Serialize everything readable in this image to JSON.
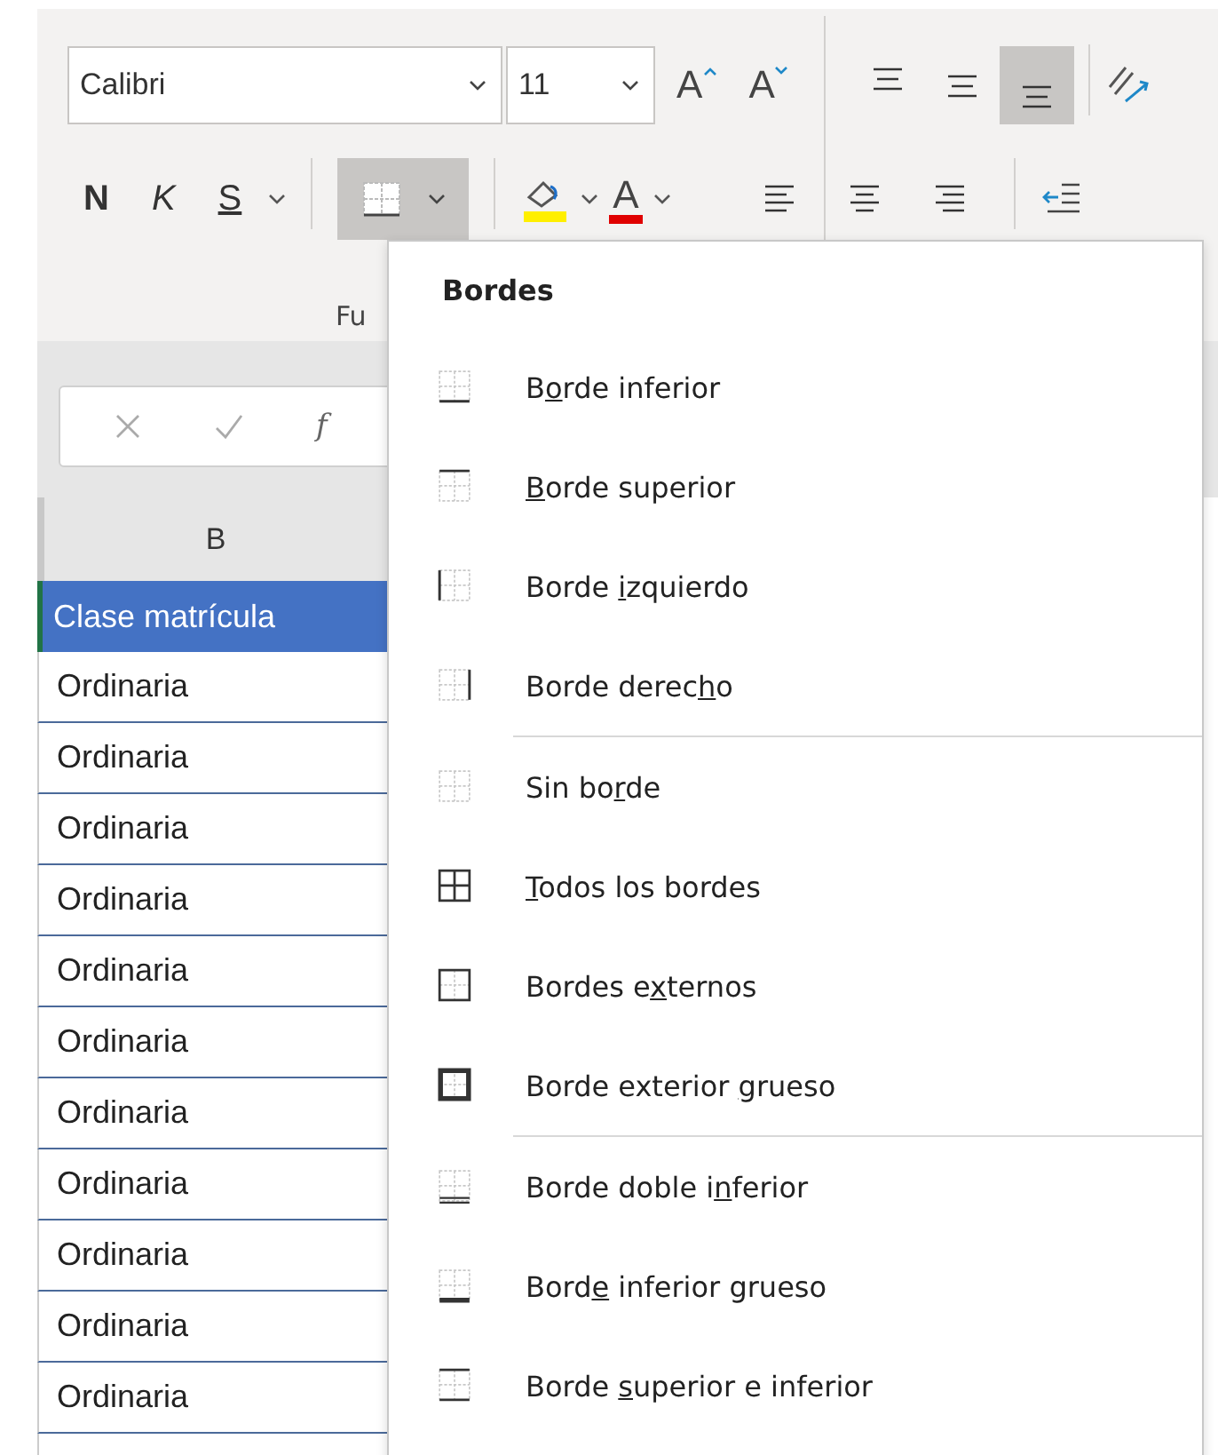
{
  "ribbon": {
    "font_name": {
      "value": "Calibri"
    },
    "font_size": {
      "value": "11"
    },
    "grow_font": "A",
    "shrink_font": "A",
    "style_buttons": [
      {
        "kind": "bold",
        "label": "N"
      },
      {
        "kind": "italic",
        "label": "K"
      },
      {
        "kind": "underline",
        "label": "S"
      }
    ],
    "borders_button": {
      "selected": true
    },
    "font_color": {
      "label": "A"
    },
    "vertical_align": [
      {
        "kind": "top",
        "selected": false
      },
      {
        "kind": "middle",
        "selected": false
      },
      {
        "kind": "bottom",
        "selected": true
      }
    ],
    "horizontal_align": [
      {
        "kind": "left",
        "selected": false
      },
      {
        "kind": "center",
        "selected": false
      },
      {
        "kind": "right",
        "selected": false
      }
    ],
    "group_label": "Fu"
  },
  "formula_bar": {
    "function_label": "f"
  },
  "sheet": {
    "column_header": "B",
    "header_cell": "Clase matrícula",
    "cells": [
      "Ordinaria",
      "Ordinaria",
      "Ordinaria",
      "Ordinaria",
      "Ordinaria",
      "Ordinaria",
      "Ordinaria",
      "Ordinaria",
      "Ordinaria",
      "Ordinaria",
      "Ordinaria"
    ]
  },
  "borders_menu": {
    "title": "Bordes",
    "sections": [
      [
        {
          "kind": "bottom",
          "pre": "B",
          "key": "o",
          "post": "rde inferior"
        },
        {
          "kind": "top",
          "key": "B",
          "post": "orde superior"
        },
        {
          "kind": "left",
          "pre": "Borde ",
          "key": "i",
          "post": "zquierdo"
        },
        {
          "kind": "right",
          "pre": "Borde derec",
          "key": "h",
          "post": "o"
        }
      ],
      [
        {
          "kind": "none",
          "pre": "Sin bo",
          "key": "r",
          "post": "de"
        },
        {
          "kind": "all",
          "key": "T",
          "post": "odos los bordes"
        },
        {
          "kind": "outside",
          "pre": "Bordes e",
          "key": "x",
          "post": "ternos"
        },
        {
          "kind": "thick-outside",
          "pre": "Borde exterior ",
          "key": "g",
          "post": "rueso"
        }
      ],
      [
        {
          "kind": "double-bottom",
          "pre": "Borde doble i",
          "key": "n",
          "post": "ferior"
        },
        {
          "kind": "thick-bottom",
          "pre": "Bord",
          "key": "e",
          "post": " inferior grueso"
        },
        {
          "kind": "top-bottom",
          "pre": "Borde ",
          "key": "s",
          "post": "uperior e inferior"
        }
      ]
    ]
  }
}
